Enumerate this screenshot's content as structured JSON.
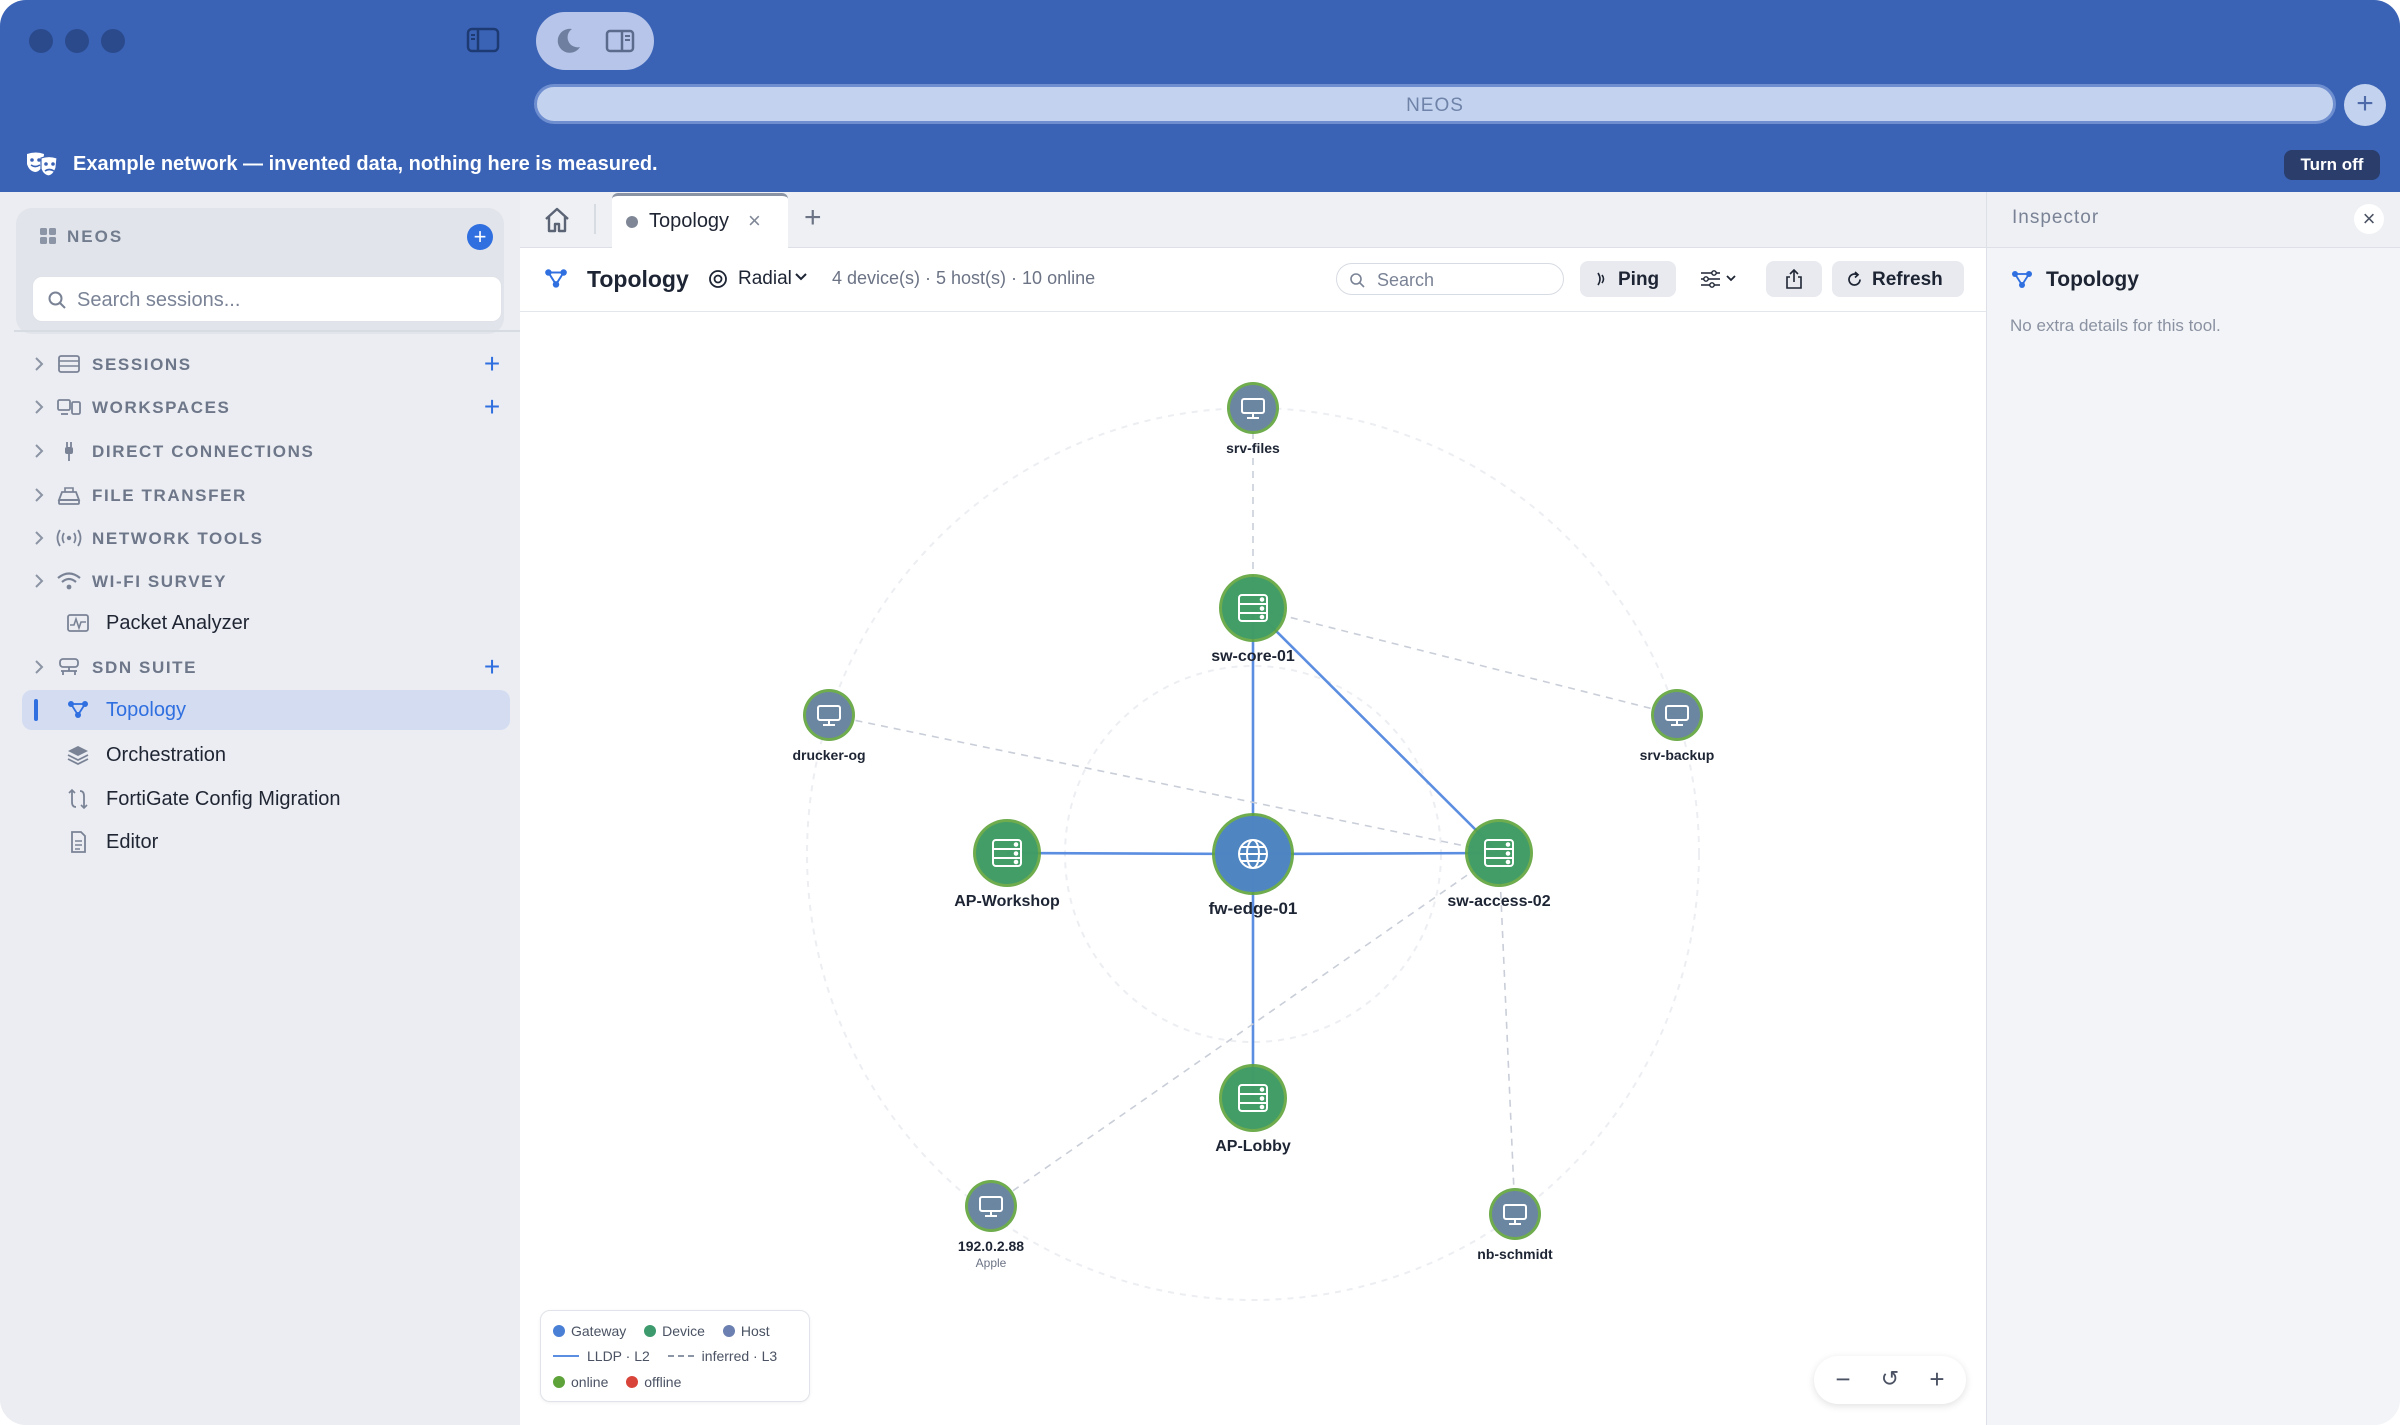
{
  "titlebar": {
    "address": "NEOS",
    "banner_text": "Example network — invented data, nothing here is measured.",
    "turn_off_label": "Turn off"
  },
  "sidebar": {
    "brand": "NEOS",
    "search_placeholder": "Search sessions...",
    "sections": [
      {
        "label": "SESSIONS",
        "icon": "sessions-icon"
      },
      {
        "label": "WORKSPACES",
        "icon": "workspaces-icon"
      },
      {
        "label": "DIRECT CONNECTIONS",
        "icon": "plug-icon"
      },
      {
        "label": "FILE TRANSFER",
        "icon": "file-transfer-icon"
      },
      {
        "label": "NETWORK TOOLS",
        "icon": "broadcast-icon"
      },
      {
        "label": "WI-FI SURVEY",
        "icon": "wifi-icon"
      },
      {
        "label": "Packet Analyzer",
        "icon": "waveform-icon"
      },
      {
        "label": "SDN SUITE",
        "icon": "sdn-icon"
      },
      {
        "label": "Topology",
        "icon": "topology-icon"
      },
      {
        "label": "Orchestration",
        "icon": "layers-icon"
      },
      {
        "label": "FortiGate Config Migration",
        "icon": "migration-icon"
      },
      {
        "label": "Editor",
        "icon": "document-icon"
      }
    ]
  },
  "tabs": [
    {
      "label": "Topology",
      "active": true
    }
  ],
  "toolbar": {
    "title": "Topology",
    "layout": "Radial",
    "stats": "4 device(s) · 5 host(s) · 10 online",
    "search_placeholder": "Search",
    "ping_label": "Ping",
    "refresh_label": "Refresh"
  },
  "topology": {
    "nodes": [
      {
        "id": "fw-edge-01",
        "label": "fw-edge-01",
        "kind": "gateway",
        "status": "online"
      },
      {
        "id": "sw-core-01",
        "label": "sw-core-01",
        "kind": "device",
        "status": "online"
      },
      {
        "id": "AP-Workshop",
        "label": "AP-Workshop",
        "kind": "device",
        "status": "online"
      },
      {
        "id": "sw-access-02",
        "label": "sw-access-02",
        "kind": "device",
        "status": "online"
      },
      {
        "id": "AP-Lobby",
        "label": "AP-Lobby",
        "kind": "device",
        "status": "online"
      },
      {
        "id": "srv-files",
        "label": "srv-files",
        "kind": "host",
        "status": "online"
      },
      {
        "id": "drucker-og",
        "label": "drucker-og",
        "kind": "host",
        "status": "online"
      },
      {
        "id": "srv-backup",
        "label": "srv-backup",
        "kind": "host",
        "status": "online"
      },
      {
        "id": "192.0.2.88",
        "label": "192.0.2.88",
        "sublabel": "Apple",
        "kind": "host",
        "status": "online"
      },
      {
        "id": "nb-schmidt",
        "label": "nb-schmidt",
        "kind": "host",
        "status": "online"
      }
    ],
    "links": [
      {
        "from": "fw-edge-01",
        "to": "sw-core-01",
        "type": "lldp"
      },
      {
        "from": "fw-edge-01",
        "to": "AP-Workshop",
        "type": "lldp"
      },
      {
        "from": "fw-edge-01",
        "to": "sw-access-02",
        "type": "lldp"
      },
      {
        "from": "fw-edge-01",
        "to": "AP-Lobby",
        "type": "lldp"
      },
      {
        "from": "sw-core-01",
        "to": "sw-access-02",
        "type": "lldp"
      },
      {
        "from": "sw-core-01",
        "to": "srv-files",
        "type": "inferred"
      },
      {
        "from": "sw-core-01",
        "to": "srv-backup",
        "type": "inferred"
      },
      {
        "from": "sw-access-02",
        "to": "drucker-og",
        "type": "inferred"
      },
      {
        "from": "sw-access-02",
        "to": "192.0.2.88",
        "type": "inferred"
      },
      {
        "from": "sw-access-02",
        "to": "nb-schmidt",
        "type": "inferred"
      }
    ]
  },
  "legend": {
    "gateway": "Gateway",
    "device": "Device",
    "host": "Host",
    "lldp": "LLDP · L2",
    "inferred": "inferred · L3",
    "online": "online",
    "offline": "offline"
  },
  "colors": {
    "gateway": "#4a7fd6",
    "device": "#3c9a6c",
    "host": "#6b7fb0",
    "online": "#5ea33a",
    "offline": "#d9443a",
    "lldp": "#5b8de0"
  },
  "inspector": {
    "title": "Inspector",
    "tool_name": "Topology",
    "description": "No extra details for this tool."
  }
}
